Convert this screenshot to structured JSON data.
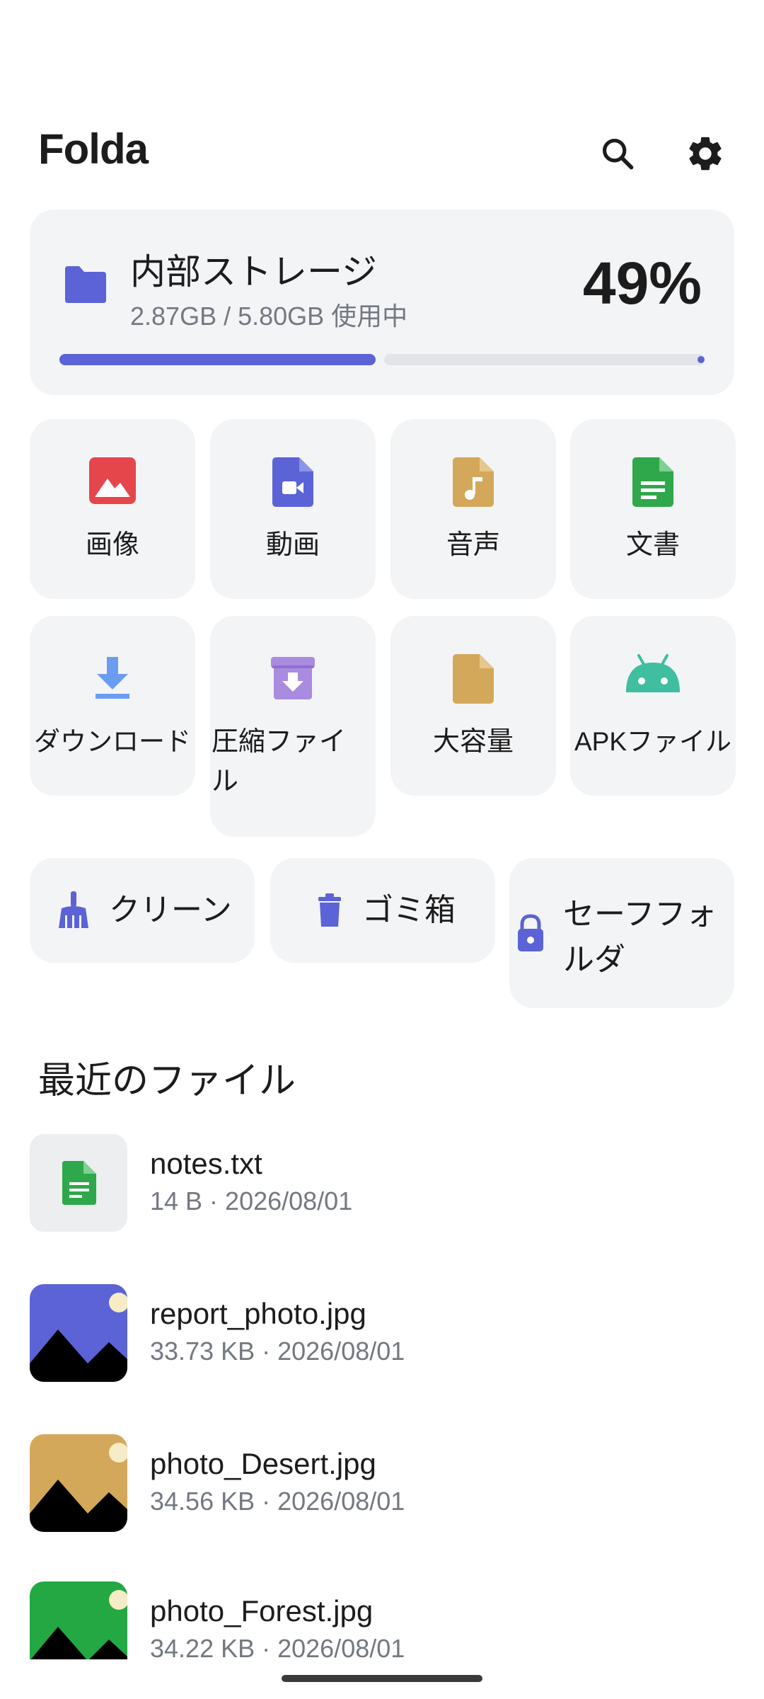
{
  "app_bar": {
    "title": "Folda",
    "search_icon": "search-icon",
    "settings_icon": "gear-icon"
  },
  "storage": {
    "title": "内部ストレージ",
    "usage": "2.87GB / 5.80GB 使用中",
    "percent_label": "49%",
    "used_fraction": 0.49,
    "icon": "folder-icon",
    "accent": "#5b63d6"
  },
  "categories": [
    {
      "label": "画像",
      "icon": "image-icon",
      "color": "#e5464c"
    },
    {
      "label": "動画",
      "icon": "video-file-icon",
      "color": "#5b63d6"
    },
    {
      "label": "音声",
      "icon": "audio-file-icon",
      "color": "#d4a85a"
    },
    {
      "label": "文書",
      "icon": "document-icon",
      "color": "#2ea84a"
    },
    {
      "label": "ダウンロード",
      "icon": "download-icon",
      "color": "#6a9cf2"
    },
    {
      "label": "圧縮ファイル",
      "icon": "archive-icon",
      "color": "#a98be0"
    },
    {
      "label": "大容量",
      "icon": "large-file-icon",
      "color": "#d4a85a"
    },
    {
      "label": "APKファイル",
      "icon": "android-icon",
      "color": "#3fbf9f"
    }
  ],
  "quick_actions": [
    {
      "label": "クリーン",
      "icon": "broom-icon"
    },
    {
      "label": "ゴミ箱",
      "icon": "trash-icon"
    },
    {
      "label": "セーフフォルダ",
      "icon": "lock-icon"
    }
  ],
  "recent": {
    "title": "最近のファイル",
    "files": [
      {
        "name": "notes.txt",
        "meta": "14 B · 2026/08/01",
        "thumb": "document-icon",
        "thumb_color": "#2ea84a"
      },
      {
        "name": "report_photo.jpg",
        "meta": "33.73 KB · 2026/08/01",
        "thumb": "photo-thumbnail",
        "thumb_color": "#5b63d6"
      },
      {
        "name": "photo_Desert.jpg",
        "meta": "34.56 KB · 2026/08/01",
        "thumb": "photo-thumbnail",
        "thumb_color": "#d4a85a"
      },
      {
        "name": "photo_Forest.jpg",
        "meta": "34.22 KB · 2026/08/01",
        "thumb": "photo-thumbnail",
        "thumb_color": "#23a843"
      }
    ]
  }
}
